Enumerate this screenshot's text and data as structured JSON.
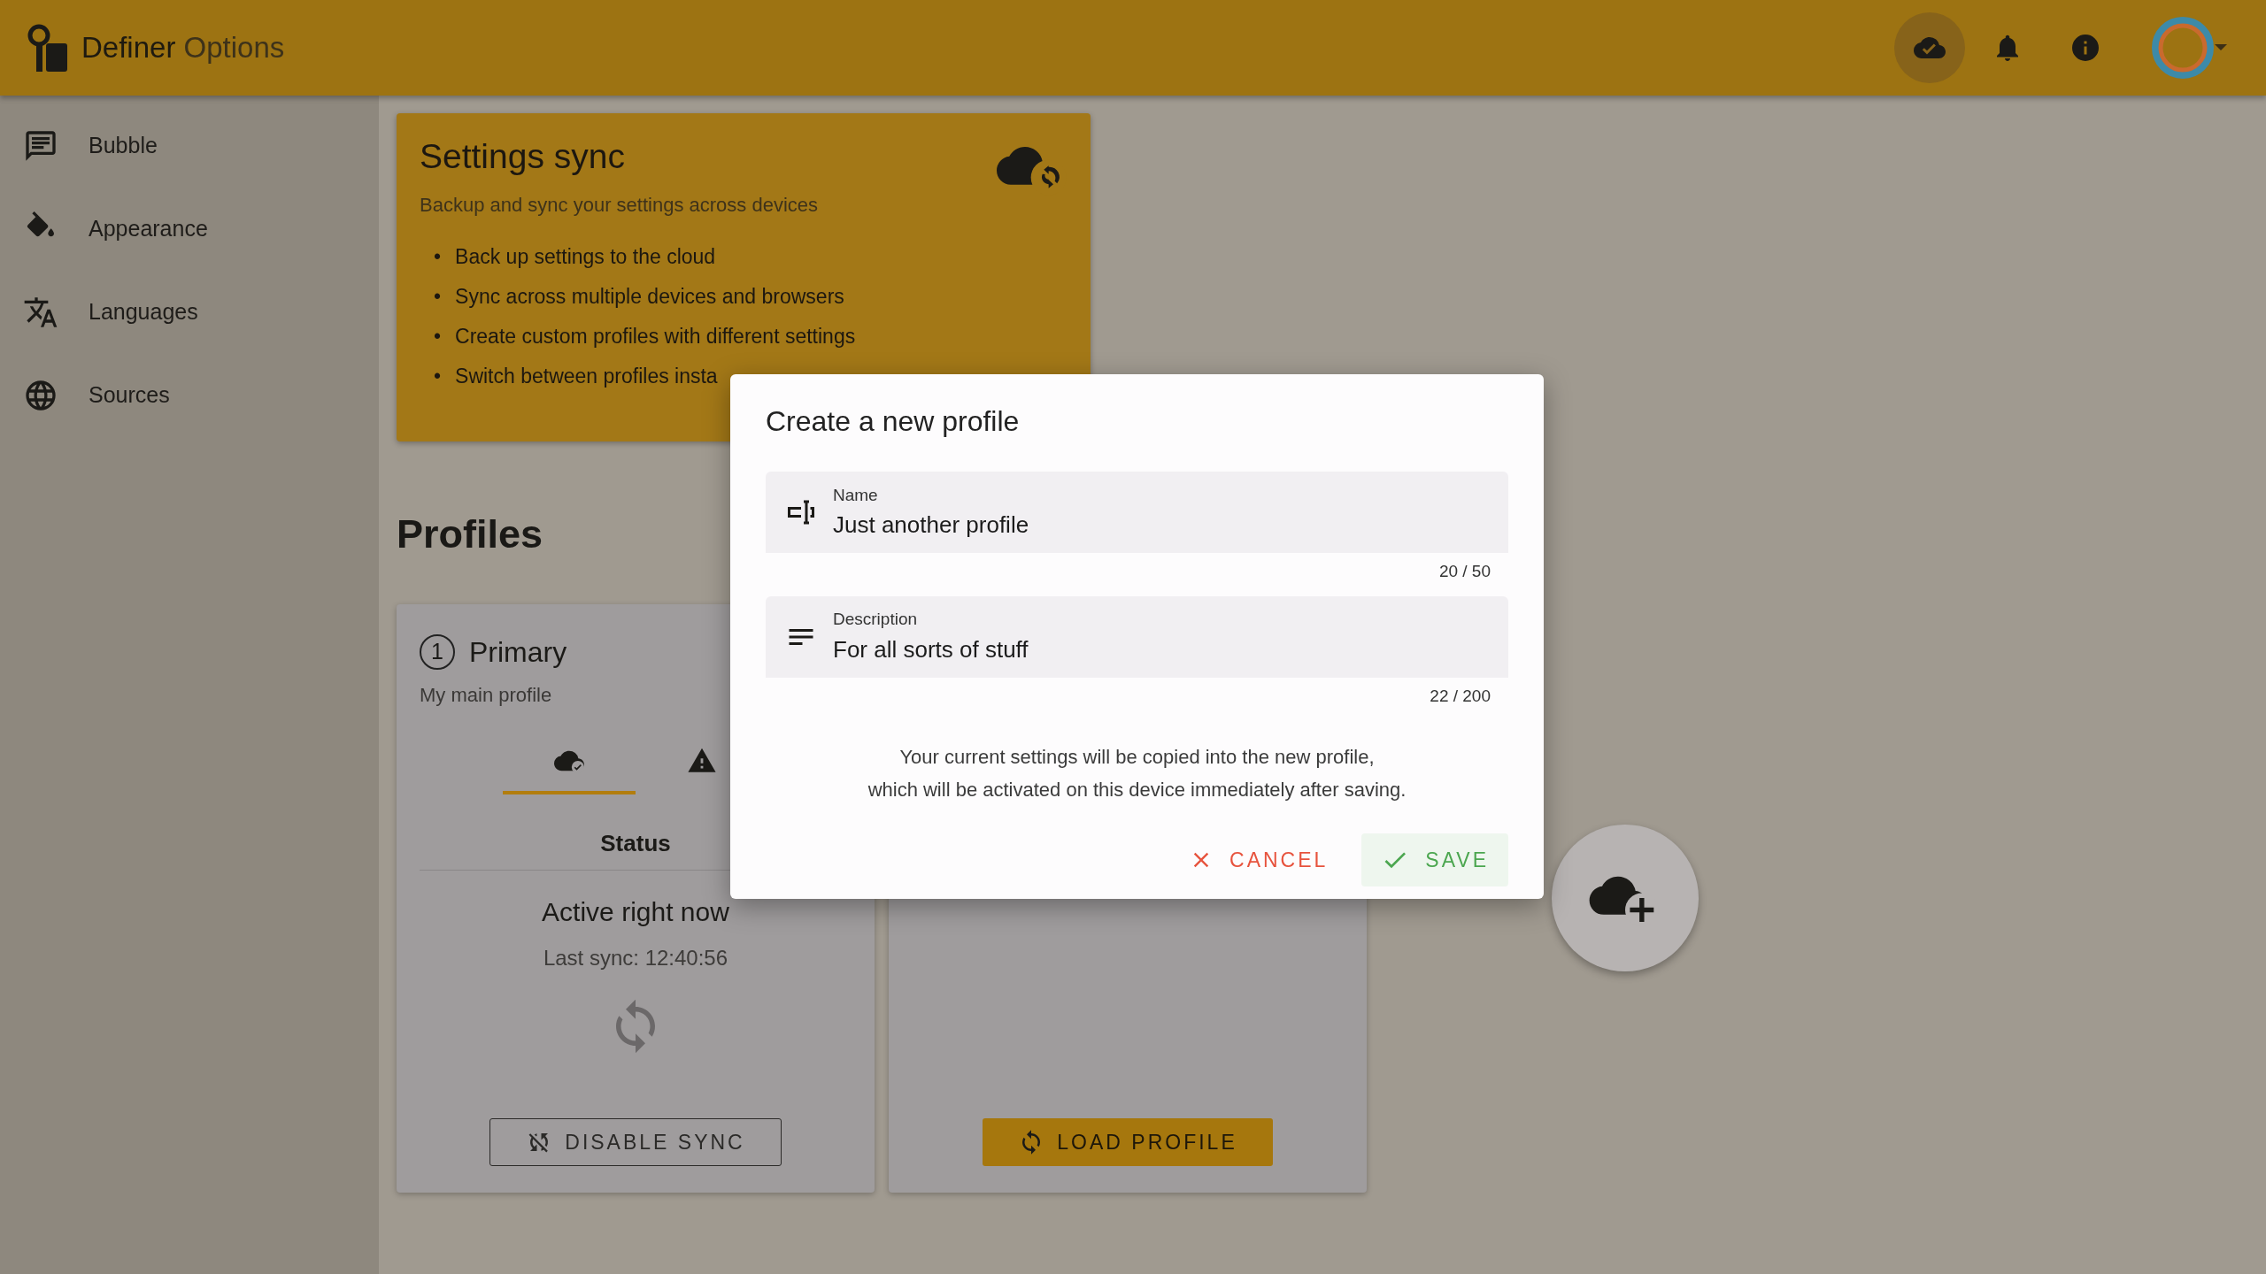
{
  "header": {
    "app_name": "Definer",
    "app_suffix": "Options",
    "actions": [
      {
        "selected": true
      },
      {
        "selected": false
      },
      {
        "selected": false
      }
    ]
  },
  "sidebar": {
    "items": [
      {
        "label": "Bubble"
      },
      {
        "label": "Appearance"
      },
      {
        "label": "Languages"
      },
      {
        "label": "Sources"
      }
    ]
  },
  "sync_card": {
    "title": "Settings sync",
    "subtitle": "Backup and sync your settings across devices",
    "features": [
      {
        "marker": "•",
        "text": "Back up settings to the cloud"
      },
      {
        "marker": "•",
        "text": "Sync across multiple devices and browsers"
      },
      {
        "marker": "•",
        "text": "Create custom profiles with different settings"
      },
      {
        "marker": "•",
        "text": "Switch between profiles insta"
      }
    ]
  },
  "profiles": {
    "heading": "Profiles",
    "cards": [
      {
        "number": "1",
        "name": "Primary",
        "description": "My main profile",
        "tabs": [
          {
            "selected": true
          },
          {
            "selected": false
          }
        ],
        "status_heading": "Status",
        "status": "Active right now",
        "last_sync": "Last sync: 12:40:56",
        "button": {
          "kind": "outline",
          "label": "DISABLE SYNC"
        }
      },
      {
        "button": {
          "kind": "filled",
          "label": "LOAD PROFILE"
        }
      }
    ]
  },
  "dialog": {
    "title": "Create a new profile",
    "fields": [
      {
        "label": "Name",
        "value": "Just another profile",
        "counter": "20 / 50"
      },
      {
        "label": "Description",
        "value": "For all sorts of stuff",
        "counter": "22 / 200"
      }
    ],
    "message": "Your current settings will be copied into the new profile,\nwhich will be activated on this device immediately after saving.",
    "buttons": [
      {
        "kind": "cancel",
        "label": "CANCEL",
        "hovered": false
      },
      {
        "kind": "save",
        "label": "SAVE",
        "hovered": true
      }
    ]
  }
}
